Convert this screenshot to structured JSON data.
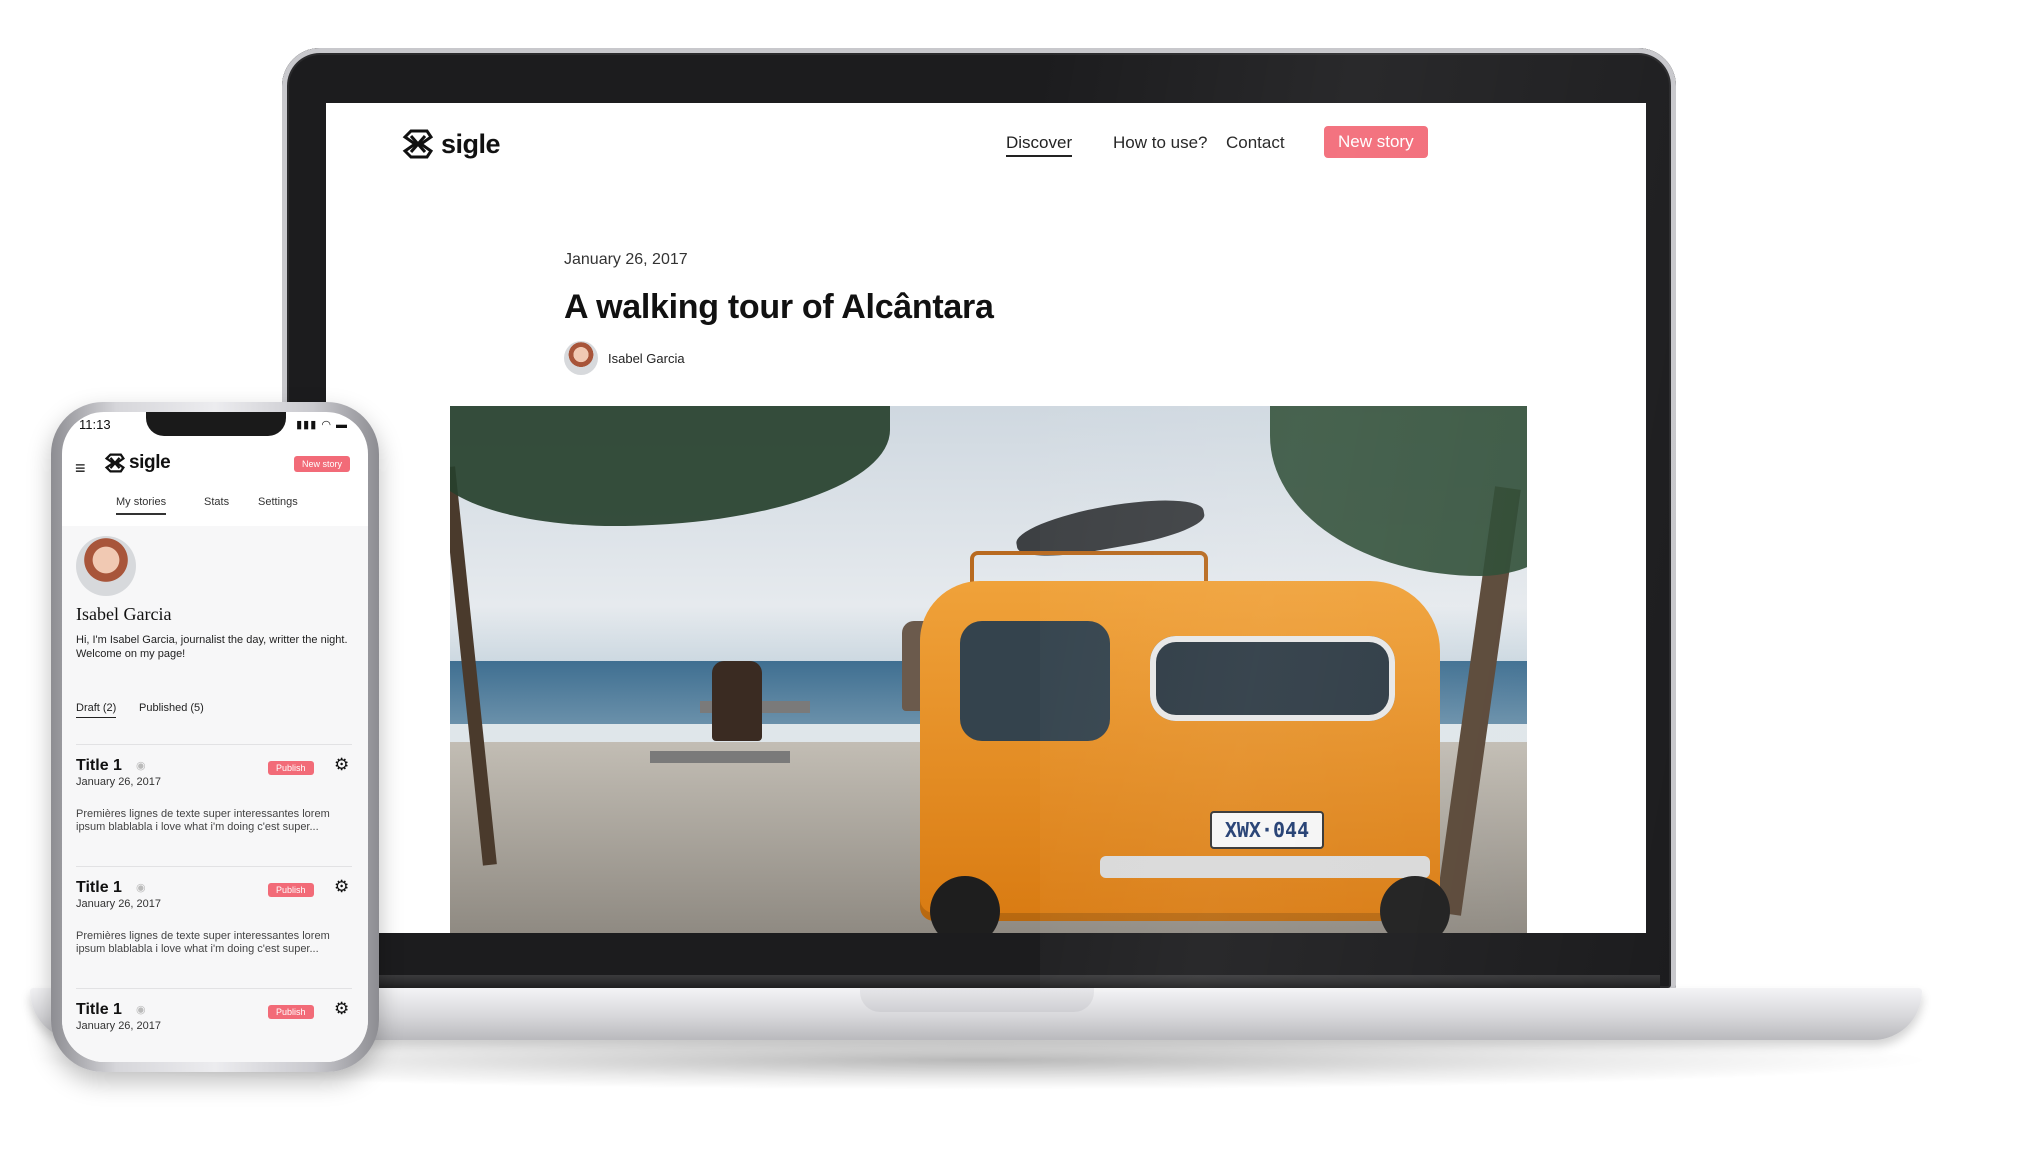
{
  "desktop": {
    "logo_text": "sigle",
    "nav": {
      "discover": "Discover",
      "how_to_use": "How to use?",
      "contact": "Contact",
      "new_story": "New story"
    },
    "article": {
      "date": "January 26, 2017",
      "title": "A walking tour of Alcântara",
      "author": "Isabel Garcia"
    },
    "hero": {
      "plate_text": "XWX·044"
    }
  },
  "mobile": {
    "status_time": "11:13",
    "status_icons": "▮▮▮ ◠ ▬",
    "menu_icon": "≡",
    "logo_text": "sigle",
    "new_story": "New story",
    "tabs": [
      "My stories",
      "Stats",
      "Settings"
    ],
    "profile": {
      "name": "Isabel Garcia",
      "bio_line1": "Hi, I'm Isabel Garcia, journalist the day, writter the night.",
      "bio_line2": "Welcome on my page!"
    },
    "subtabs": [
      "Draft (2)",
      "Published (5)"
    ],
    "stories": [
      {
        "title": "Title 1",
        "date": "January 26, 2017",
        "publish": "Publish",
        "excerpt": "Premières lignes de texte super interessantes lorem ipsum blablabla i love what i'm doing c'est super..."
      },
      {
        "title": "Title 1",
        "date": "January 26, 2017",
        "publish": "Publish",
        "excerpt": "Premières lignes de texte super interessantes lorem ipsum blablabla i love what i'm doing c'est super..."
      },
      {
        "title": "Title 1",
        "date": "January 26, 2017",
        "publish": "Publish",
        "excerpt": ""
      }
    ],
    "eye_icon": "◉",
    "gear_icon": "⚙"
  },
  "colors": {
    "accent": "#f26b78",
    "van_orange": "#e88a1f"
  }
}
